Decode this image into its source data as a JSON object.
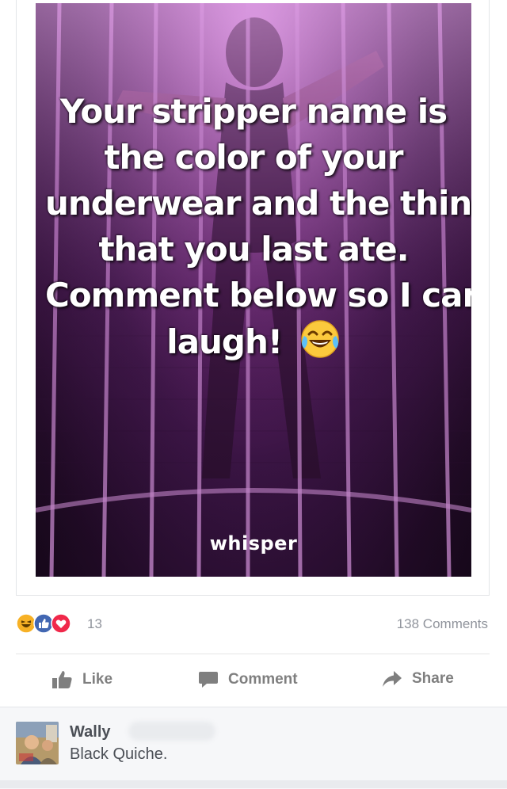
{
  "post": {
    "image_caption_lines": [
      "Your stripper name is",
      "the color of your",
      "underwear and the thing",
      "that you last ate.",
      "Comment below so I can",
      "laugh!"
    ],
    "image_emoji": "face-with-tears-of-joy-icon",
    "watermark": "whisper"
  },
  "reactions": {
    "icons": [
      "haha-reaction-icon",
      "like-reaction-icon",
      "love-reaction-icon"
    ],
    "count": "13",
    "comments_label": "138 Comments"
  },
  "actions": {
    "like_label": "Like",
    "comment_label": "Comment",
    "share_label": "Share"
  },
  "comment": {
    "author": "Wally",
    "text": "Black Quiche."
  },
  "colors": {
    "like_blue": "#4267b2",
    "love_red": "#f0284a",
    "haha_yellow": "#f7b125",
    "meta_gray": "#90949c",
    "action_gray": "#7f7f7f",
    "comment_bg": "#f6f7f9"
  }
}
